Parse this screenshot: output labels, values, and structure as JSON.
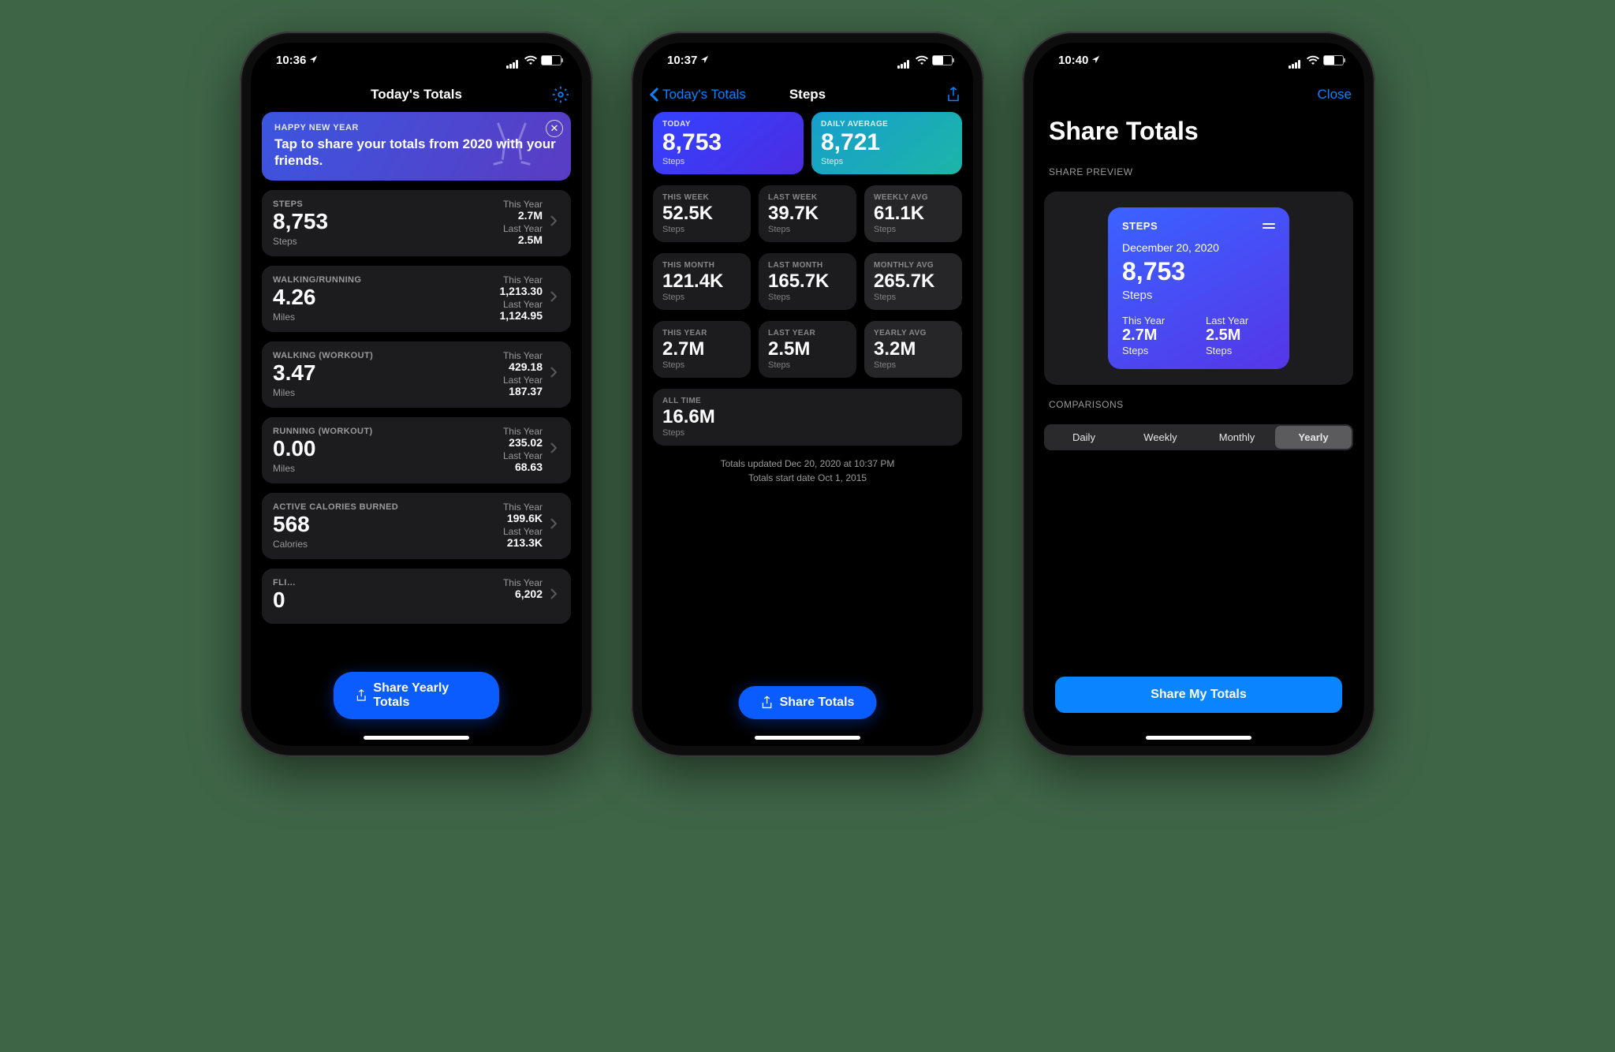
{
  "screen1": {
    "status_time": "10:36",
    "nav_title": "Today's Totals",
    "banner": {
      "subtitle": "HAPPY NEW YEAR",
      "message": "Tap to share your totals from 2020 with your friends."
    },
    "metrics": [
      {
        "title": "STEPS",
        "value": "8,753",
        "unit": "Steps",
        "this_label": "This Year",
        "this_value": "2.7M",
        "last_label": "Last Year",
        "last_value": "2.5M"
      },
      {
        "title": "WALKING/RUNNING",
        "value": "4.26",
        "unit": "Miles",
        "this_label": "This Year",
        "this_value": "1,213.30",
        "last_label": "Last Year",
        "last_value": "1,124.95"
      },
      {
        "title": "WALKING (WORKOUT)",
        "value": "3.47",
        "unit": "Miles",
        "this_label": "This Year",
        "this_value": "429.18",
        "last_label": "Last Year",
        "last_value": "187.37"
      },
      {
        "title": "RUNNING (WORKOUT)",
        "value": "0.00",
        "unit": "Miles",
        "this_label": "This Year",
        "this_value": "235.02",
        "last_label": "Last Year",
        "last_value": "68.63"
      },
      {
        "title": "ACTIVE CALORIES BURNED",
        "value": "568",
        "unit": "Calories",
        "this_label": "This Year",
        "this_value": "199.6K",
        "last_label": "Last Year",
        "last_value": "213.3K"
      },
      {
        "title": "FLI…",
        "value": "0",
        "unit": "",
        "this_label": "This Year",
        "this_value": "6,202",
        "last_label": "",
        "last_value": ""
      }
    ],
    "fab": "Share Yearly Totals"
  },
  "screen2": {
    "status_time": "10:37",
    "back": "Today's Totals",
    "title": "Steps",
    "today": {
      "label": "TODAY",
      "value": "8,753",
      "unit": "Steps"
    },
    "avg": {
      "label": "DAILY AVERAGE",
      "value": "8,721",
      "unit": "Steps"
    },
    "rows": [
      [
        {
          "label": "THIS WEEK",
          "value": "52.5K",
          "unit": "Steps"
        },
        {
          "label": "LAST WEEK",
          "value": "39.7K",
          "unit": "Steps"
        },
        {
          "label": "WEEKLY AVG",
          "value": "61.1K",
          "unit": "Steps"
        }
      ],
      [
        {
          "label": "THIS MONTH",
          "value": "121.4K",
          "unit": "Steps"
        },
        {
          "label": "LAST MONTH",
          "value": "165.7K",
          "unit": "Steps"
        },
        {
          "label": "MONTHLY AVG",
          "value": "265.7K",
          "unit": "Steps"
        }
      ],
      [
        {
          "label": "THIS YEAR",
          "value": "2.7M",
          "unit": "Steps"
        },
        {
          "label": "LAST YEAR",
          "value": "2.5M",
          "unit": "Steps"
        },
        {
          "label": "YEARLY AVG",
          "value": "3.2M",
          "unit": "Steps"
        }
      ]
    ],
    "alltime": {
      "label": "ALL TIME",
      "value": "16.6M",
      "unit": "Steps"
    },
    "foot1": "Totals updated Dec 20, 2020 at 10:37 PM",
    "foot2": "Totals start date Oct 1, 2015",
    "fab": "Share Totals"
  },
  "screen3": {
    "status_time": "10:40",
    "close": "Close",
    "title": "Share Totals",
    "preview_label": "SHARE PREVIEW",
    "card": {
      "title": "STEPS",
      "date": "December 20, 2020",
      "value": "8,753",
      "unit": "Steps",
      "this_label": "This Year",
      "this_value": "2.7M",
      "last_label": "Last Year",
      "last_value": "2.5M"
    },
    "comparisons_label": "COMPARISONS",
    "segments": [
      "Daily",
      "Weekly",
      "Monthly",
      "Yearly"
    ],
    "selected_segment": "Yearly",
    "button": "Share My Totals"
  }
}
